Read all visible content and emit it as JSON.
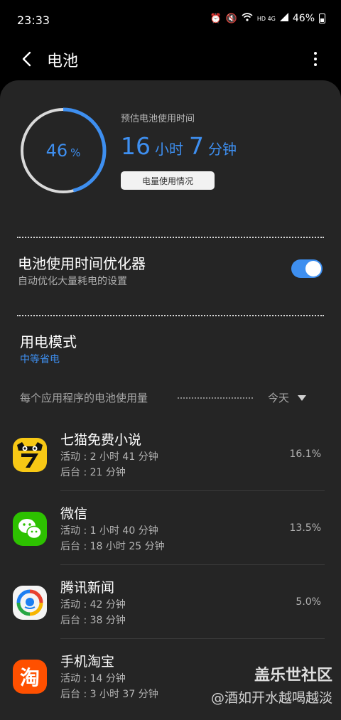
{
  "status_bar": {
    "time": "23:33",
    "network_label": "HD 4G",
    "battery_percent_text": "46%"
  },
  "header": {
    "title": "电池"
  },
  "battery": {
    "level_percent": 46,
    "percent_number": "46",
    "percent_sign": "%",
    "estimate_label": "预估电池使用时间",
    "estimate_hours": "16",
    "hours_unit": "小时",
    "estimate_minutes": "7",
    "minutes_unit": "分钟",
    "usage_button_label": "电量使用情况",
    "accent_color": "#3e8ff0"
  },
  "optimizer": {
    "title": "电池使用时间优化器",
    "subtitle": "自动优化大量耗电的设置",
    "enabled": true
  },
  "power_mode": {
    "title": "用电模式",
    "value": "中等省电"
  },
  "app_usage": {
    "header": "每个应用程序的电池使用量",
    "period": "今天",
    "apps": [
      {
        "name": "七猫免费小说",
        "active": "活动 : 2 小时 41 分钟",
        "background": "后台 : 21 分钟",
        "percent": "16.1%",
        "icon": "qimao-cat-icon"
      },
      {
        "name": "微信",
        "active": "活动 : 1 小时 40 分钟",
        "background": "后台 : 18 小时 25 分钟",
        "percent": "13.5%",
        "icon": "wechat-icon"
      },
      {
        "name": "腾讯新闻",
        "active": "活动 : 42 分钟",
        "background": "后台 : 38 分钟",
        "percent": "5.0%",
        "icon": "tencent-news-icon"
      },
      {
        "name": "手机淘宝",
        "active": "活动 : 14 分钟",
        "background": "后台 : 3 小时 37 分钟",
        "percent": "",
        "icon": "taobao-icon",
        "icon_text": "淘"
      }
    ]
  },
  "watermark": {
    "line1": "盖乐世社区",
    "line2": "@酒如开水越喝越淡"
  }
}
